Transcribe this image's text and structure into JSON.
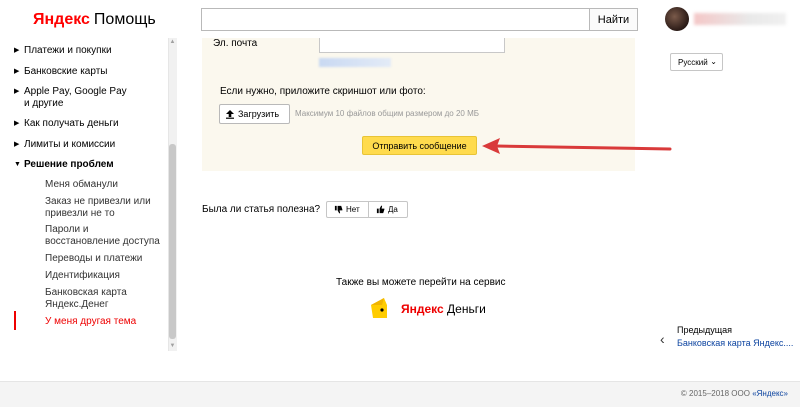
{
  "header": {
    "logo_brand": "Яндекс",
    "logo_product": "Помощь",
    "search_value": "",
    "search_button": "Найти"
  },
  "sidebar": {
    "items": [
      {
        "label": "Платежи и покупки"
      },
      {
        "label": "Банковские карты"
      },
      {
        "label": "Apple Pay, Google Pay"
      },
      {
        "label": "и другие"
      },
      {
        "label": "Как получать деньги"
      },
      {
        "label": "Лимиты и комиссии"
      },
      {
        "label": "Решение проблем"
      }
    ],
    "subitems": [
      {
        "label": "Меня обманули"
      },
      {
        "label": "Заказ не привезли или"
      },
      {
        "label": "привезли не то"
      },
      {
        "label": "Пароли и"
      },
      {
        "label": "восстановление доступа"
      },
      {
        "label": "Переводы и платежи"
      },
      {
        "label": "Идентификация"
      },
      {
        "label": "Банковская карта"
      },
      {
        "label": "Яндекс.Денег"
      },
      {
        "label": "У меня другая тема"
      }
    ]
  },
  "form": {
    "email_label": "Эл. почта",
    "email_value": "",
    "attach_label": "Если нужно, приложите скриншот или фото:",
    "upload_button": "Загрузить",
    "upload_hint": "Максимум 10 файлов общим размером до 20 МБ",
    "send_button": "Отправить сообщение"
  },
  "language": {
    "selected": "Русский"
  },
  "feedback": {
    "question": "Была ли статья полезна?",
    "no": "Нет",
    "yes": "Да"
  },
  "service": {
    "label": "Также вы можете перейти на сервис",
    "brand": "Яндекс",
    "product": "Деньги"
  },
  "prev": {
    "label": "Предыдущая",
    "link": "Банковская карта Яндекс...."
  },
  "footer": {
    "copyright": "© 2015–2018 ООО ",
    "company": "«Яндекс»"
  },
  "colors": {
    "accent_red": "#e00000",
    "button_yellow": "#ffdb4d",
    "panel_bg": "#fbf8ee",
    "link_blue": "#0d44a0"
  }
}
